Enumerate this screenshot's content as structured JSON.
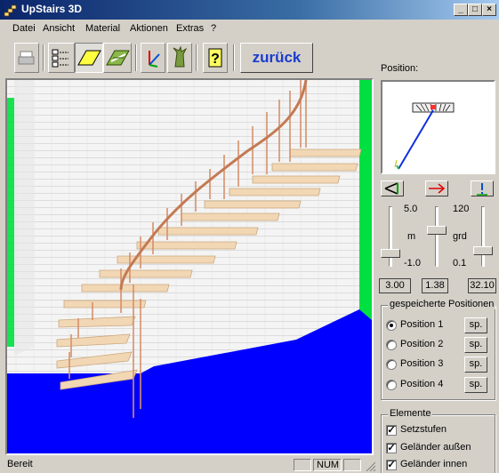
{
  "window": {
    "title": "UpStairs 3D"
  },
  "menu": [
    {
      "label": "Datei",
      "accel": "D"
    },
    {
      "label": "Ansicht",
      "accel": "A"
    },
    {
      "label": "Material",
      "accel": ""
    },
    {
      "label": "Aktionen",
      "accel": ""
    },
    {
      "label": "Extras",
      "accel": ""
    },
    {
      "label": "?",
      "accel": ""
    }
  ],
  "toolbar": {
    "back_label": "zurück"
  },
  "side": {
    "position_label": "Position:",
    "slider1": {
      "max": "5.0",
      "unit": "m",
      "min": "-1.0",
      "value": "3.00",
      "level": 0.17
    },
    "slider2": {
      "value": "1.38",
      "level": 0.62
    },
    "slider3": {
      "max": "120",
      "unit": "grd",
      "min": "0.1",
      "value": "32.10",
      "level": 0.23
    },
    "saved": {
      "title": "gespeicherte Positionen",
      "items": [
        {
          "label": "Position 1",
          "selected": true,
          "btn": "sp."
        },
        {
          "label": "Position 2",
          "selected": false,
          "btn": "sp."
        },
        {
          "label": "Position 3",
          "selected": false,
          "btn": "sp."
        },
        {
          "label": "Position 4",
          "selected": false,
          "btn": "sp."
        }
      ]
    },
    "elements": {
      "title": "Elemente",
      "items": [
        {
          "label": "Setzstufen",
          "checked": true
        },
        {
          "label": "Geländer außen",
          "checked": true
        },
        {
          "label": "Geländer innen",
          "checked": true
        }
      ]
    }
  },
  "status": {
    "text": "Bereit",
    "num": "NUM"
  },
  "colors": {
    "title_start": "#0a246a",
    "floor": "#0000ff",
    "edge": "#00e040",
    "wood": "#f2d7b5",
    "rail": "#d6906a"
  }
}
